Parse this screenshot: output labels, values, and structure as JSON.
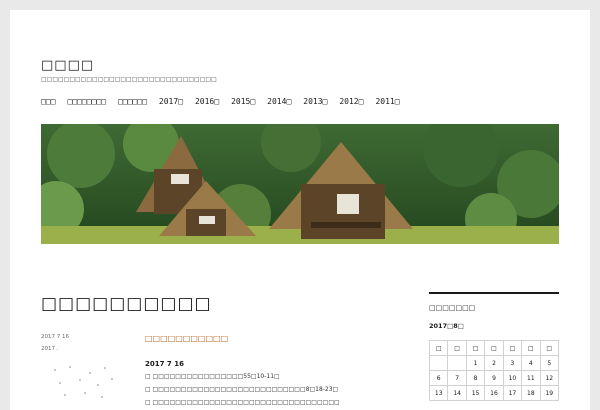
{
  "site": {
    "title": "□□□□",
    "description": "□□□□□□□□□□□□□□□□□□□□□□□□□□□□□□□"
  },
  "menu": [
    "□□□",
    "□□□□□□□□",
    "□□□□□□",
    "2017□",
    "2016□",
    "2015□",
    "2014□",
    "2013□",
    "2012□",
    "2011□"
  ],
  "page": {
    "title": "□□□□□□□□□□",
    "meta_date": "2017 7 16",
    "meta_cat": "2017 ."
  },
  "post": {
    "link": "□□□□□□□□□□□",
    "date": "2017 7 16",
    "lines": [
      "□ □□□□□□□□□□□□□□□□55□10-11□",
      "□ □□□□□□□□□□□□□□□□□□□□□□□□□□□8□18-23□",
      "□ □□□□□□□□□□□□□□□□□□□□□□□□□□□□□□□□□"
    ]
  },
  "sidebar": {
    "widget_title": "□□□□□□□",
    "calendar_caption": "2017□8□",
    "weekdays": [
      "□",
      "□",
      "□",
      "□",
      "□",
      "□",
      "□"
    ],
    "weeks": [
      [
        "",
        "",
        "1",
        "2",
        "3",
        "4",
        "5"
      ],
      [
        "6",
        "7",
        "8",
        "9",
        "10",
        "11",
        "12"
      ],
      [
        "13",
        "14",
        "15",
        "16",
        "17",
        "18",
        "19"
      ]
    ]
  },
  "colors": {
    "accent": "#b5651d",
    "background": "#e9e9e9"
  }
}
